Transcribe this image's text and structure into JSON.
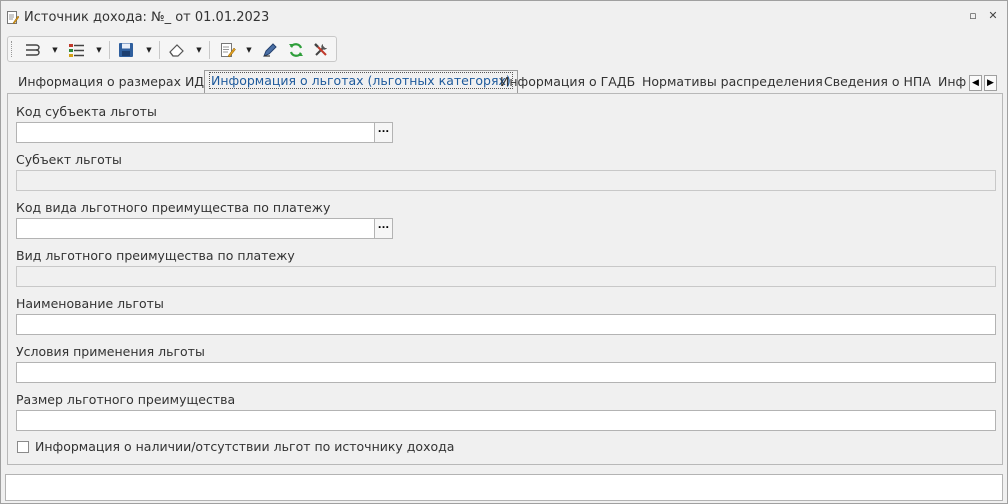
{
  "window": {
    "title": "Источник дохода: №_ от 01.01.2023",
    "restore_glyph": "▫",
    "close_glyph": "✕"
  },
  "toolbar": {
    "dropdown_glyph": "▼",
    "buttons": [
      {
        "name": "relations-icon"
      },
      {
        "name": "status-icon"
      },
      {
        "name": "save-icon"
      },
      {
        "name": "eraser-icon"
      },
      {
        "name": "document-edit-icon"
      },
      {
        "name": "pen-icon"
      },
      {
        "name": "refresh-icon"
      },
      {
        "name": "tools-icon"
      }
    ]
  },
  "tabs": {
    "items": [
      "Информация о размерах ИД",
      "Информация о льготах (льготных категорях)",
      "Информация о ГАДБ",
      "Нормативы распределения",
      "Сведения о НПА",
      "Инф"
    ],
    "active_index": 1,
    "scroll_left": "◀",
    "scroll_right": "▶"
  },
  "form": {
    "subject_code_label": "Код субъекта льготы",
    "subject_code_value": "",
    "subject_label": "Субъект льготы",
    "subject_value": "",
    "benefit_type_code_label": "Код вида льготного преимущества по платежу",
    "benefit_type_code_value": "",
    "benefit_type_label": "Вид льготного преимущества по платежу",
    "benefit_type_value": "",
    "benefit_name_label": "Наименование льготы",
    "benefit_name_value": "",
    "conditions_label": "Условия применения льготы",
    "conditions_value": "",
    "amount_label": "Размер льготного преимущества",
    "amount_value": "",
    "ellipsis": "...",
    "availability_checkbox_label": "Информация о наличии/отсутствии льгот по источнику дохода",
    "availability_checked": false
  },
  "status_field": {
    "value": ""
  },
  "colors": {
    "window_bg": "#f0f0f0",
    "active_tab_text": "#1e5a9c",
    "border": "#b3b3b3"
  }
}
